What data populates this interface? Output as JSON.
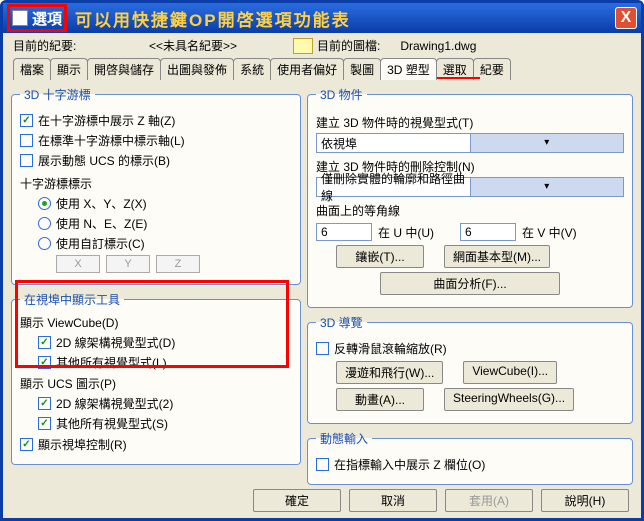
{
  "title": {
    "label": "選項",
    "subtitle": "可以用快捷鍵OP開啓選項功能表"
  },
  "close": "X",
  "header": {
    "curprof": "目前的紀要:",
    "unnamed": "<<未具名紀要>>",
    "curdraw": "目前的圖檔:",
    "file": "Drawing1.dwg"
  },
  "tabs": [
    "檔案",
    "顯示",
    "開啓與儲存",
    "出圖與發佈",
    "系統",
    "使用者偏好",
    "製圖",
    "3D 塑型",
    "選取",
    "紀要"
  ],
  "left": {
    "g1": {
      "legend": "3D 十字游標",
      "c1": "在十字游標中展示 Z 軸(Z)",
      "c2": "在標準十字游標中標示軸(L)",
      "c3": "展示動態 UCS 的標示(B)",
      "sub": "十字游標標示",
      "r1": "使用 X、Y、Z(X)",
      "r2": "使用 N、E、Z(E)",
      "r3": "使用自訂標示(C)",
      "x": "X",
      "y": "Y",
      "z": "Z"
    },
    "g2": {
      "legend": "在視埠中顯示工具",
      "s1": "顯示 ViewCube(D)",
      "c1": "2D 線架構視覺型式(D)",
      "c2": "其他所有視覺型式(L)",
      "s2": "顯示 UCS 圖示(P)",
      "c3": "2D 線架構視覺型式(2)",
      "c4": "其他所有視覺型式(S)",
      "c5": "顯示視埠控制(R)"
    }
  },
  "right": {
    "g1": {
      "legend": "3D 物件",
      "l1": "建立 3D 物件時的視覺型式(T)",
      "d1": "依視埠",
      "l2": "建立 3D 物件時的刪除控制(N)",
      "d2": "僅刪除實體的輪廓和路徑曲線",
      "l3": "曲面上的等角線",
      "n1": "6",
      "u": "在 U 中(U)",
      "n2": "6",
      "v": "在 V 中(V)",
      "b1": "鑲嵌(T)...",
      "b2": "網面基本型(M)...",
      "b3": "曲面分析(F)..."
    },
    "g2": {
      "legend": "3D 導覽",
      "c1": "反轉滑鼠滾輪縮放(R)",
      "b1": "漫遊和飛行(W)...",
      "b2": "ViewCube(I)...",
      "b3": "動畫(A)...",
      "b4": "SteeringWheels(G)..."
    },
    "g3": {
      "legend": "動態輸入",
      "c1": "在指標輸入中展示 Z 欄位(O)"
    }
  },
  "footer": {
    "ok": "確定",
    "cancel": "取消",
    "apply": "套用(A)",
    "help": "說明(H)"
  }
}
